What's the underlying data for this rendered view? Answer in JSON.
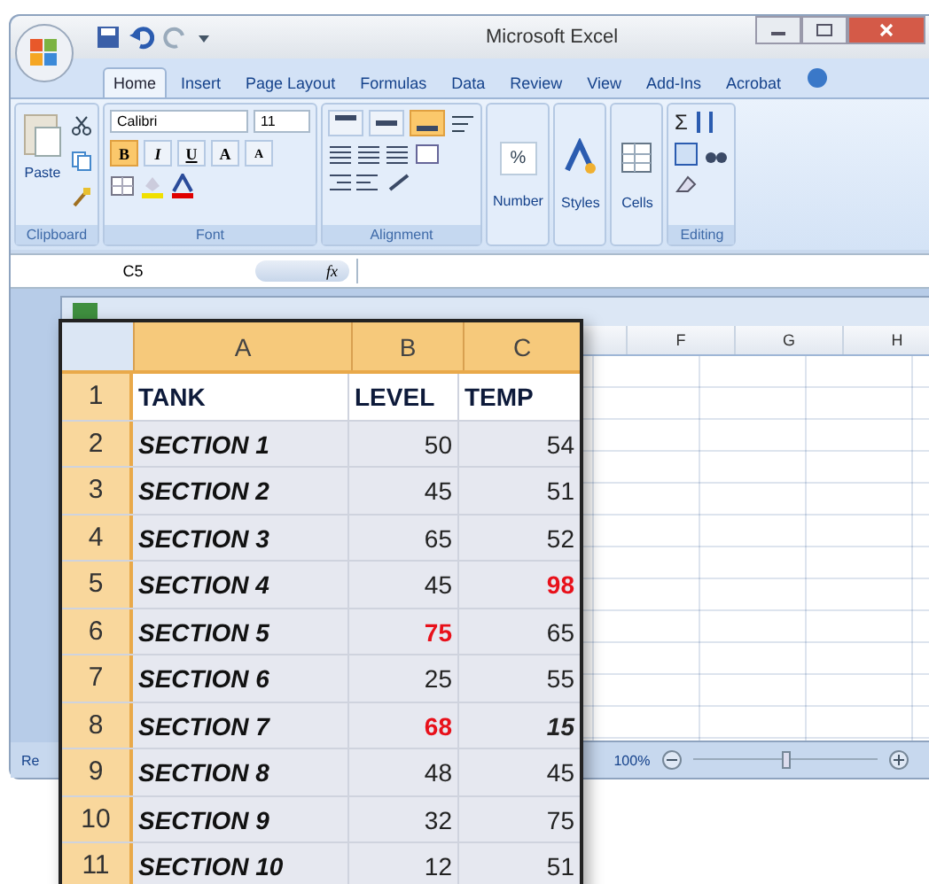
{
  "window": {
    "title": "Microsoft Excel"
  },
  "ribbon_tabs": [
    {
      "label": "Home",
      "selected": true
    },
    {
      "label": "Insert",
      "selected": false
    },
    {
      "label": "Page Layout",
      "selected": false
    },
    {
      "label": "Formulas",
      "selected": false
    },
    {
      "label": "Data",
      "selected": false
    },
    {
      "label": "Review",
      "selected": false
    },
    {
      "label": "View",
      "selected": false
    },
    {
      "label": "Add-Ins",
      "selected": false
    },
    {
      "label": "Acrobat",
      "selected": false
    }
  ],
  "ribbon": {
    "clipboard": {
      "label": "Clipboard",
      "paste": "Paste"
    },
    "font": {
      "label": "Font",
      "family": "Calibri",
      "size": "11",
      "style_buttons": [
        {
          "label": "B",
          "selected": true
        },
        {
          "label": "I",
          "selected": false
        },
        {
          "label": "U",
          "selected": false
        }
      ],
      "size_buttons": [
        "A",
        "A"
      ]
    },
    "alignment": {
      "label": "Alignment",
      "buttons": [
        {
          "kind": "top",
          "selected": false
        },
        {
          "kind": "middle",
          "selected": false
        },
        {
          "kind": "bottom",
          "selected": true
        }
      ]
    },
    "collapsed_groups": [
      {
        "kind": "number",
        "icon_text": "%",
        "label": "Number"
      },
      {
        "kind": "styles",
        "label": "Styles"
      },
      {
        "kind": "cells",
        "label": "Cells"
      }
    ],
    "editing": {
      "label": "Editing",
      "autosum": "Σ"
    }
  },
  "formula_bar": {
    "name_box": "C5",
    "fx": "fx"
  },
  "sheet": {
    "columns": [
      "F",
      "G",
      "H"
    ],
    "sheet_tab": "Re",
    "zoom": "100%",
    "zoom_slider": {
      "level": 0.5
    }
  },
  "zoom_view": {
    "columns": [
      "A",
      "B",
      "C"
    ],
    "rows": [
      {
        "number": "1",
        "kind": "header",
        "tank": "TANK",
        "level": "LEVEL",
        "temp": "TEMP"
      },
      {
        "number": "2",
        "kind": "data",
        "tank": "SECTION 1",
        "level": {
          "text": "50",
          "alert": false,
          "italic": false
        },
        "temp": {
          "text": "54",
          "alert": false,
          "italic": false
        }
      },
      {
        "number": "3",
        "kind": "data",
        "tank": "SECTION 2",
        "level": {
          "text": "45",
          "alert": false,
          "italic": false
        },
        "temp": {
          "text": "51",
          "alert": false,
          "italic": false
        }
      },
      {
        "number": "4",
        "kind": "data",
        "tank": "SECTION 3",
        "level": {
          "text": "65",
          "alert": false,
          "italic": false
        },
        "temp": {
          "text": "52",
          "alert": false,
          "italic": false
        }
      },
      {
        "number": "5",
        "kind": "data",
        "tank": "SECTION 4",
        "level": {
          "text": "45",
          "alert": false,
          "italic": false
        },
        "temp": {
          "text": "98",
          "alert": true,
          "italic": false
        }
      },
      {
        "number": "6",
        "kind": "data",
        "tank": "SECTION 5",
        "level": {
          "text": "75",
          "alert": true,
          "italic": false
        },
        "temp": {
          "text": "65",
          "alert": false,
          "italic": false
        }
      },
      {
        "number": "7",
        "kind": "data",
        "tank": "SECTION 6",
        "level": {
          "text": "25",
          "alert": false,
          "italic": false
        },
        "temp": {
          "text": "55",
          "alert": false,
          "italic": false
        }
      },
      {
        "number": "8",
        "kind": "data",
        "tank": "SECTION 7",
        "level": {
          "text": "68",
          "alert": true,
          "italic": false
        },
        "temp": {
          "text": "15",
          "alert": false,
          "italic": true
        }
      },
      {
        "number": "9",
        "kind": "data",
        "tank": "SECTION 8",
        "level": {
          "text": "48",
          "alert": false,
          "italic": false
        },
        "temp": {
          "text": "45",
          "alert": false,
          "italic": false
        }
      },
      {
        "number": "10",
        "kind": "data",
        "tank": "SECTION 9",
        "level": {
          "text": "32",
          "alert": false,
          "italic": false
        },
        "temp": {
          "text": "75",
          "alert": false,
          "italic": false
        }
      },
      {
        "number": "11",
        "kind": "data",
        "tank": "SECTION 10",
        "level": {
          "text": "12",
          "alert": false,
          "italic": false
        },
        "temp": {
          "text": "51",
          "alert": false,
          "italic": false
        }
      }
    ]
  }
}
